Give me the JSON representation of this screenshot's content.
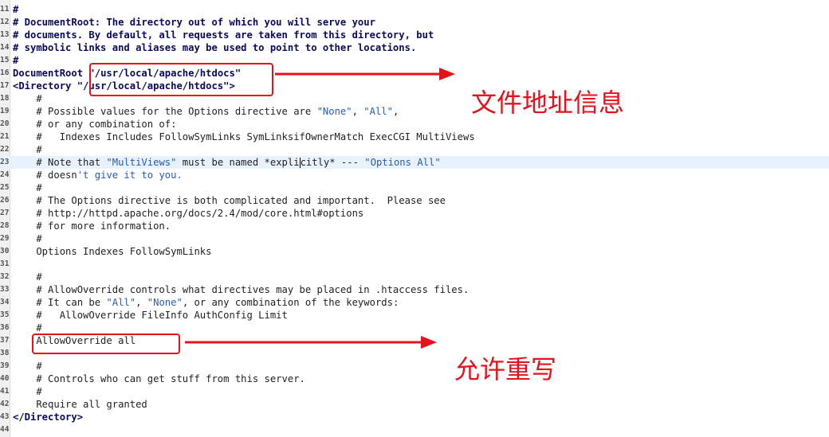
{
  "lines": [
    {
      "n": "11",
      "segs": [
        {
          "t": "#",
          "k": "c-bold"
        }
      ]
    },
    {
      "n": "12",
      "segs": [
        {
          "t": "# DocumentRoot: The directory out of which you will serve your",
          "k": "c-bold"
        }
      ]
    },
    {
      "n": "13",
      "segs": [
        {
          "t": "# documents. By default, all requests are taken from this directory, but",
          "k": "c-bold"
        }
      ]
    },
    {
      "n": "14",
      "segs": [
        {
          "t": "# symbolic links and aliases may be used to point to other locations.",
          "k": "c-bold"
        }
      ]
    },
    {
      "n": "15",
      "segs": [
        {
          "t": "#",
          "k": "c-bold"
        }
      ]
    },
    {
      "n": "16",
      "segs": [
        {
          "t": "DocumentRoot ",
          "k": "c-tag"
        },
        {
          "t": "\"/usr/local/apache/htdocs\"",
          "k": "c-tag"
        }
      ]
    },
    {
      "n": "17",
      "segs": [
        {
          "t": "<Directory ",
          "k": "c-tag"
        },
        {
          "t": "\"/usr/local/apache/htdocs\">",
          "k": "c-tag"
        }
      ]
    },
    {
      "n": "18",
      "segs": [
        {
          "t": "    #",
          "k": ""
        }
      ]
    },
    {
      "n": "19",
      "segs": [
        {
          "t": "    # Possible values for the Options directive are ",
          "k": ""
        },
        {
          "t": "\"None\"",
          "k": "str"
        },
        {
          "t": ", ",
          "k": ""
        },
        {
          "t": "\"All\"",
          "k": "str"
        },
        {
          "t": ",",
          "k": ""
        }
      ]
    },
    {
      "n": "20",
      "segs": [
        {
          "t": "    # or any combination of:",
          "k": ""
        }
      ]
    },
    {
      "n": "21",
      "segs": [
        {
          "t": "    #   Indexes Includes FollowSymLinks SymLinksifOwnerMatch ExecCGI MultiViews",
          "k": ""
        }
      ]
    },
    {
      "n": "22",
      "segs": [
        {
          "t": "    #",
          "k": ""
        }
      ]
    },
    {
      "n": "23",
      "current": true,
      "segs": [
        {
          "t": "    # Note that ",
          "k": ""
        },
        {
          "t": "\"MultiViews\"",
          "k": "str"
        },
        {
          "t": " must be named *expli",
          "k": ""
        },
        {
          "t": "|caret|",
          "k": "caret"
        },
        {
          "t": "citly* --- ",
          "k": ""
        },
        {
          "t": "\"Options All\"",
          "k": "str"
        }
      ]
    },
    {
      "n": "24",
      "segs": [
        {
          "t": "    # doesn",
          "k": ""
        },
        {
          "t": "'t give it to you.",
          "k": "str"
        }
      ]
    },
    {
      "n": "25",
      "segs": [
        {
          "t": "    #",
          "k": ""
        }
      ]
    },
    {
      "n": "26",
      "segs": [
        {
          "t": "    # The Options directive is both complicated and important.  Please see",
          "k": ""
        }
      ]
    },
    {
      "n": "27",
      "segs": [
        {
          "t": "    # http://httpd.apache.org/docs/2.4/mod/core.html#options",
          "k": ""
        }
      ]
    },
    {
      "n": "28",
      "segs": [
        {
          "t": "    # for more information.",
          "k": ""
        }
      ]
    },
    {
      "n": "29",
      "segs": [
        {
          "t": "    #",
          "k": ""
        }
      ]
    },
    {
      "n": "30",
      "segs": [
        {
          "t": "    Options Indexes FollowSymLinks",
          "k": ""
        }
      ]
    },
    {
      "n": "31",
      "segs": [
        {
          "t": "",
          "k": ""
        }
      ]
    },
    {
      "n": "32",
      "segs": [
        {
          "t": "    #",
          "k": ""
        }
      ]
    },
    {
      "n": "33",
      "segs": [
        {
          "t": "    # AllowOverride controls what directives may be placed in .htaccess files.",
          "k": ""
        }
      ]
    },
    {
      "n": "34",
      "segs": [
        {
          "t": "    # It can be ",
          "k": ""
        },
        {
          "t": "\"All\"",
          "k": "str"
        },
        {
          "t": ", ",
          "k": ""
        },
        {
          "t": "\"None\"",
          "k": "str"
        },
        {
          "t": ", or any combination of the keywords:",
          "k": ""
        }
      ]
    },
    {
      "n": "35",
      "segs": [
        {
          "t": "    #   AllowOverride FileInfo AuthConfig Limit",
          "k": ""
        }
      ]
    },
    {
      "n": "36",
      "segs": [
        {
          "t": "    #",
          "k": ""
        }
      ]
    },
    {
      "n": "37",
      "segs": [
        {
          "t": "    AllowOverride all",
          "k": ""
        }
      ]
    },
    {
      "n": "38",
      "segs": [
        {
          "t": "",
          "k": ""
        }
      ]
    },
    {
      "n": "39",
      "segs": [
        {
          "t": "    #",
          "k": ""
        }
      ]
    },
    {
      "n": "40",
      "segs": [
        {
          "t": "    # Controls who can get stuff from this server.",
          "k": ""
        }
      ]
    },
    {
      "n": "41",
      "segs": [
        {
          "t": "    #",
          "k": ""
        }
      ]
    },
    {
      "n": "42",
      "segs": [
        {
          "t": "    Require all granted",
          "k": ""
        }
      ]
    },
    {
      "n": "43",
      "segs": [
        {
          "t": "</Directory>",
          "k": "c-tag"
        }
      ]
    },
    {
      "n": "44",
      "segs": [
        {
          "t": "",
          "k": ""
        }
      ]
    }
  ],
  "annotations": {
    "docroot_label": "文件地址信息",
    "override_label": "允许重写"
  },
  "colors": {
    "annotation": "#e8101a",
    "string": "#2a5ab8",
    "current_line": "#e8f2fe"
  }
}
